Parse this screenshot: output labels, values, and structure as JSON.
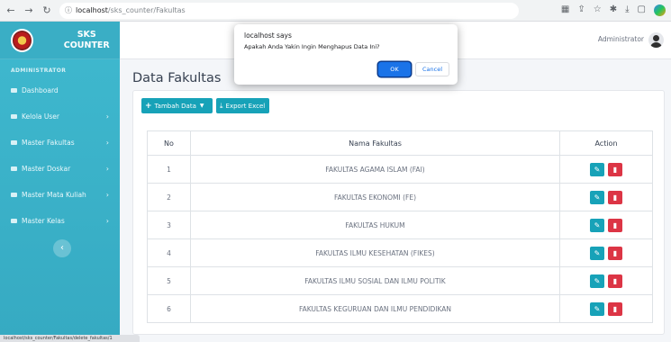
{
  "browser": {
    "url_host": "localhost",
    "url_path": "/sks_counter/Fakultas",
    "status_url": "localhost/sks_counter/Fakultas/delete_fakultas/1"
  },
  "sidebar": {
    "brand": "SKS COUNTER",
    "section": "ADMINISTRATOR",
    "items": [
      {
        "label": "Dashboard",
        "chevron": ""
      },
      {
        "label": "Kelola User",
        "chevron": "›"
      },
      {
        "label": "Master Fakultas",
        "chevron": "›"
      },
      {
        "label": "Master Doskar",
        "chevron": "›"
      },
      {
        "label": "Master Mata Kuliah",
        "chevron": "›"
      },
      {
        "label": "Master Kelas",
        "chevron": "›"
      }
    ],
    "collapse_icon": "‹"
  },
  "topbar": {
    "user": "Administrator"
  },
  "main": {
    "title": "Data Fakultas",
    "btn_tambah": "Tambah Data",
    "btn_export": "Export Excel",
    "columns": [
      "No",
      "Nama Fakultas",
      "Action"
    ],
    "rows": [
      {
        "no": "1",
        "nama": "FAKULTAS AGAMA ISLAM (FAI)"
      },
      {
        "no": "2",
        "nama": "FAKULTAS EKONOMI (FE)"
      },
      {
        "no": "3",
        "nama": "FAKULTAS HUKUM"
      },
      {
        "no": "4",
        "nama": "FAKULTAS ILMU KESEHATAN (FIKES)"
      },
      {
        "no": "5",
        "nama": "FAKULTAS ILMU SOSIAL DAN ILMU POLITIK"
      },
      {
        "no": "6",
        "nama": "FAKULTAS KEGURUAN DAN ILMU PENDIDIKAN"
      }
    ]
  },
  "dialog": {
    "title": "localhost says",
    "message": "Apakah Anda Yakin Ingin Menghapus Data Ini?",
    "ok": "OK",
    "cancel": "Cancel"
  },
  "colors": {
    "sidebar": "#3fb9cf",
    "primary_button": "#17a2b8",
    "danger": "#dc3545",
    "dialog_ok": "#1a73e8"
  },
  "icons": {
    "edit": "pencil-icon",
    "delete": "trash-icon"
  }
}
